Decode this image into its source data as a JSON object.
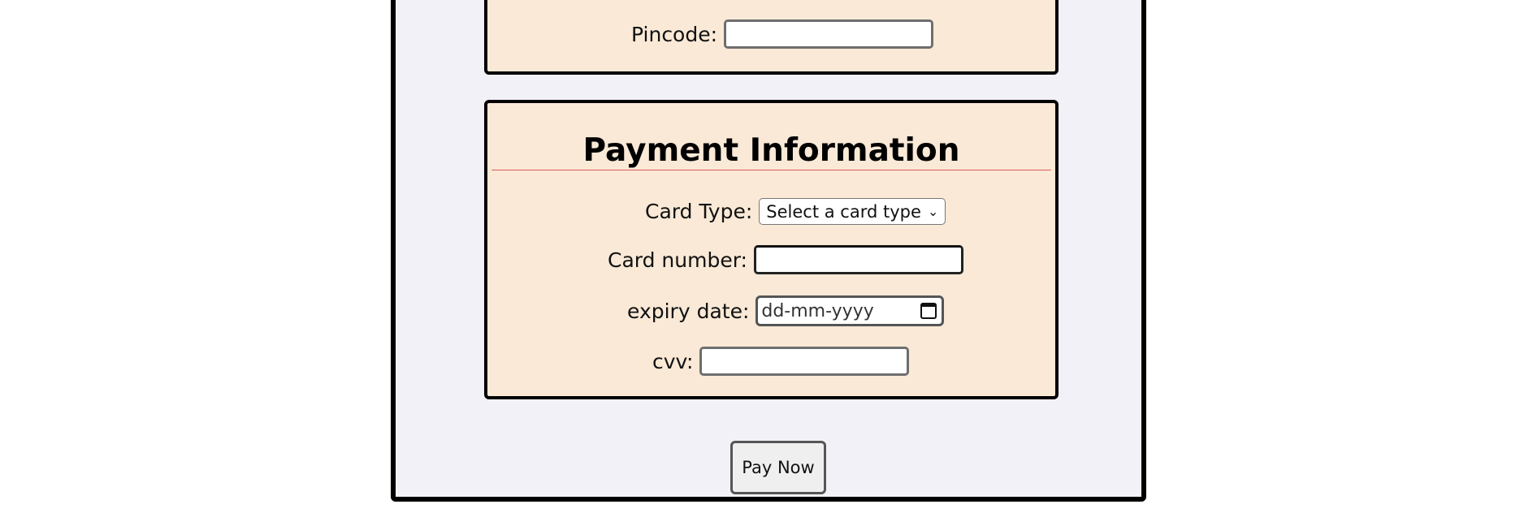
{
  "address": {
    "pincode_label": "Pincode:",
    "pincode_value": ""
  },
  "payment": {
    "title": "Payment Information",
    "card_type_label": "Card Type:",
    "card_type_selected": "Select a card type",
    "card_number_label": "Card number:",
    "card_number_value": "",
    "expiry_label": "expiry date:",
    "expiry_placeholder": "dd-mm-yyyy",
    "cvv_label": "cvv:",
    "cvv_value": ""
  },
  "actions": {
    "pay_now_label": "Pay Now"
  },
  "colors": {
    "page_background": "#f3f1f8",
    "section_background": "#f9e9d6",
    "title_underline": "#e05a5a"
  }
}
